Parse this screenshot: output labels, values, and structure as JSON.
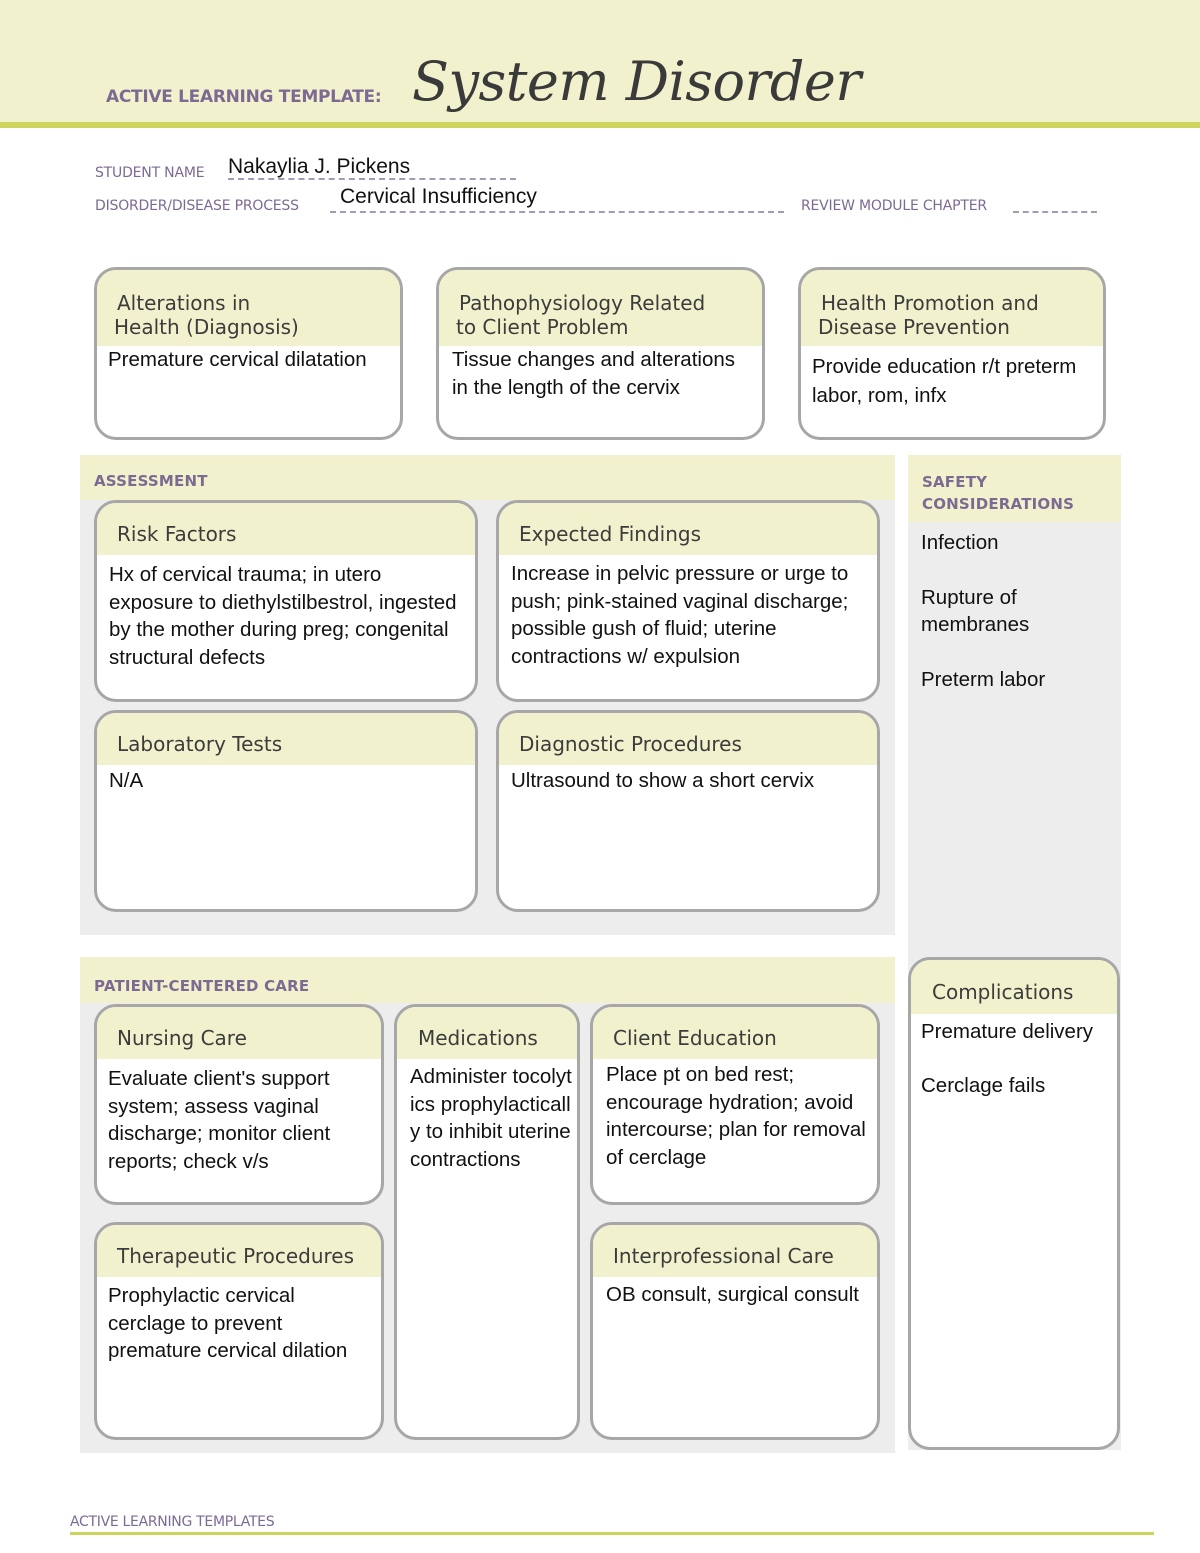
{
  "header": {
    "template_label": "ACTIVE LEARNING TEMPLATE:",
    "title": "System Disorder"
  },
  "fields": {
    "student_name_label": "STUDENT NAME",
    "student_name_value": "Nakaylia J. Pickens",
    "disorder_label": "DISORDER/DISEASE PROCESS",
    "disorder_value": "Cervical Insufficiency",
    "review_module_label": "REVIEW MODULE CHAPTER",
    "review_module_value": ""
  },
  "top_boxes": [
    {
      "title_line1": "Alterations in",
      "title_line2": "Health (Diagnosis)",
      "content": "Premature cervical dilatation"
    },
    {
      "title_line1": "Pathophysiology Related",
      "title_line2": "to Client Problem",
      "content": "Tissue changes and alterations in the length of the cervix"
    },
    {
      "title_line1": "Health Promotion and",
      "title_line2": "Disease Prevention",
      "content": "Provide education r/t preterm labor, rom, infx"
    }
  ],
  "assessment": {
    "label": "ASSESSMENT",
    "risk_factors": {
      "title": "Risk Factors",
      "content": "Hx of cervical trauma; in utero exposure to diethylstilbestrol, ingested by the mother during preg; congenital structural defects"
    },
    "expected_findings": {
      "title": "Expected Findings",
      "content": "Increase in pelvic pressure or urge to push; pink-stained vaginal discharge; possible gush of fluid; uterine contractions w/ expulsion"
    },
    "laboratory_tests": {
      "title": "Laboratory Tests",
      "content": "N/A"
    },
    "diagnostic_procedures": {
      "title": "Diagnostic Procedures",
      "content": "Ultrasound to show a short cervix"
    }
  },
  "safety": {
    "label_line1": "SAFETY",
    "label_line2": "CONSIDERATIONS",
    "items": [
      "Infection",
      "Rupture of membranes",
      "Preterm labor"
    ]
  },
  "patient_centered_care": {
    "label": "PATIENT-CENTERED CARE",
    "nursing_care": {
      "title": "Nursing Care",
      "content": "Evaluate client's support system; assess vaginal discharge; monitor client reports; check v/s"
    },
    "medications": {
      "title": "Medications",
      "content": "Administer tocolytics prophylactically to inhibit uterine contractions"
    },
    "client_education": {
      "title": "Client Education",
      "content": "Place pt on bed rest; encourage hydration; avoid intercourse; plan for removal of cerclage"
    },
    "therapeutic_procedures": {
      "title": "Therapeutic Procedures",
      "content": "Prophylactic cervical cerclage to prevent premature cervical dilation"
    },
    "interprofessional_care": {
      "title": "Interprofessional Care",
      "content": "OB consult, surgical consult"
    }
  },
  "complications": {
    "title": "Complications",
    "items": [
      "Premature delivery",
      "Cerclage fails"
    ]
  },
  "footer": {
    "label": "ACTIVE LEARNING TEMPLATES"
  },
  "colors": {
    "header_band": "#f1f2cd",
    "accent_rule": "#cdd45e",
    "label_purple": "#7d6a93",
    "panel_gray": "#ededed",
    "box_border": "#a7a7a7"
  }
}
